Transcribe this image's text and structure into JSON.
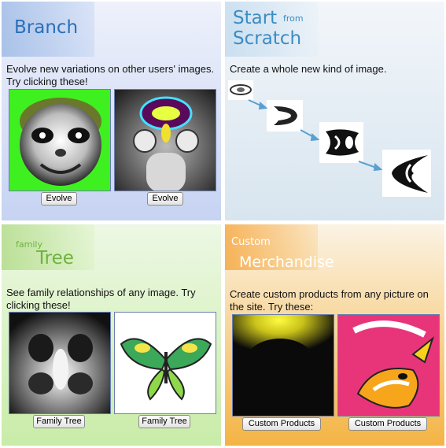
{
  "branch": {
    "title": "Branch",
    "description": "Evolve new variations on other users' images. Try clicking these!",
    "buttons": [
      "Evolve",
      "Evolve"
    ]
  },
  "scratch": {
    "title_main": "Start",
    "title_small": "from",
    "title_line2": "Scratch",
    "description": "Create a whole new kind of image."
  },
  "tree": {
    "title_small": "family",
    "title_main": "Tree",
    "description": "See family relationships of any image. Try clicking these!",
    "buttons": [
      "Family Tree",
      "Family Tree"
    ]
  },
  "merch": {
    "title_small": "Custom",
    "title_main": "Merchandise",
    "description": "Create custom products from any picture on the site. Try these:",
    "buttons": [
      "Custom Products",
      "Custom Products"
    ]
  },
  "colors": {
    "branch_title": "#2a6fb8",
    "scratch_title": "#3b8cc4",
    "tree_title": "#6fb23f",
    "merch_title": "#ffffff",
    "arrow": "#5aa0d0"
  }
}
